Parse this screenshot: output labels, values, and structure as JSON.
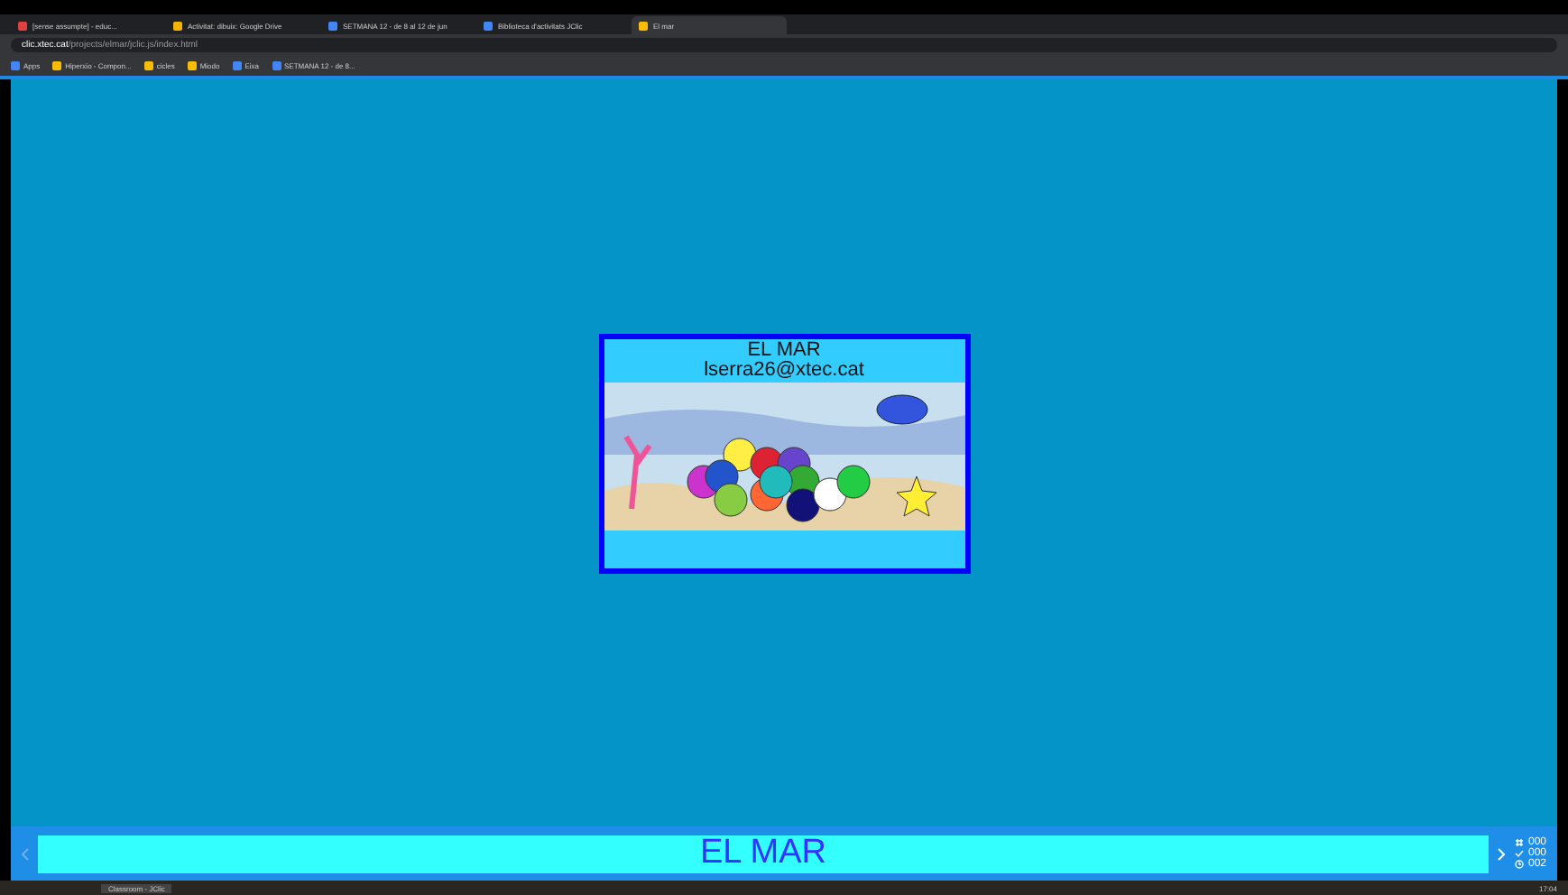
{
  "browser": {
    "tabs": [
      {
        "title": "[sense assumpte] - educ...",
        "selected": false
      },
      {
        "title": "Activitat: dibuix: Google Drive",
        "selected": false
      },
      {
        "title": "SETMANA 12 - de 8 al 12 de jun",
        "selected": false
      },
      {
        "title": "Biblioteca d'activitats JClic",
        "selected": false
      },
      {
        "title": "El mar",
        "selected": true
      }
    ],
    "address": {
      "host": "clic.xtec.cat",
      "path": "/projects/elmar/jclic.js/index.html"
    },
    "bookmarks": [
      "Apps",
      "Hiperxio - Compon...",
      "cicles",
      "Miodo",
      "Eixa",
      "SETMANA 12 - de 8..."
    ]
  },
  "card": {
    "title": "EL MAR",
    "author": "lserra26@xtec.cat"
  },
  "bottom_bar": {
    "title": "EL MAR",
    "counters": [
      "000",
      "000",
      "002"
    ]
  },
  "taskbar": {
    "window_title": "Classroom - JClic",
    "time": "17:04"
  }
}
